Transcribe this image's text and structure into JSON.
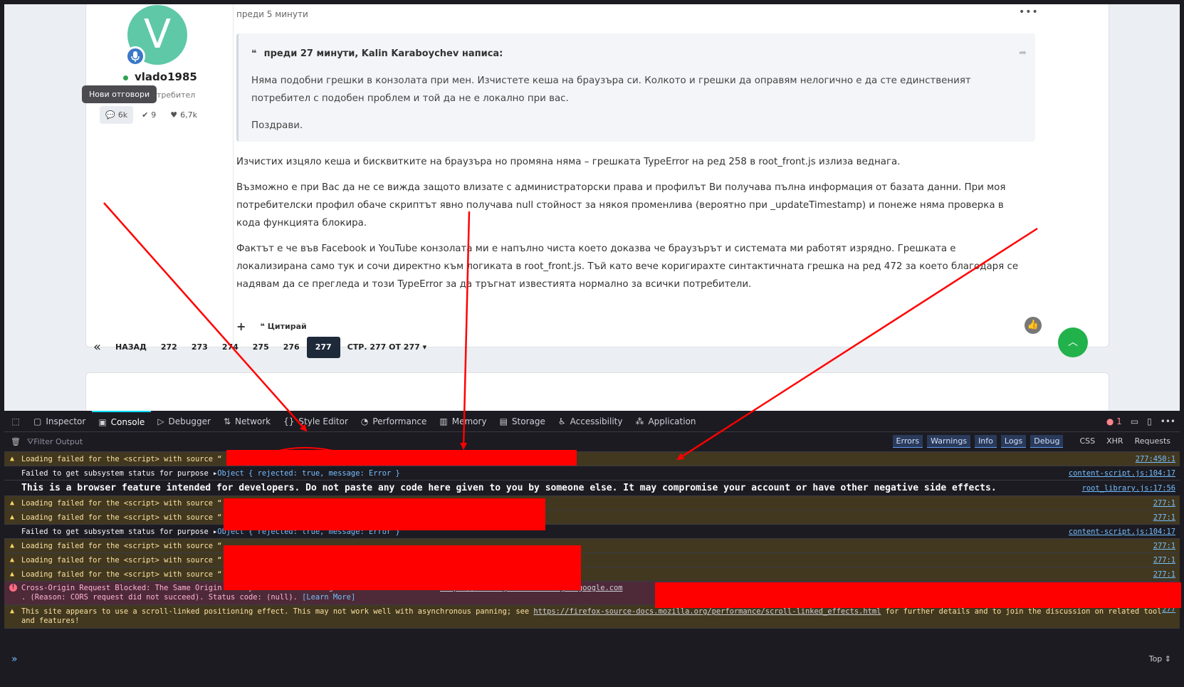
{
  "post": {
    "time": "преди 5 минути",
    "menu": "•••",
    "author": {
      "initial": "V",
      "name": "vlado1985",
      "role": "Потребител",
      "tooltip": "Нови отговори",
      "stats": {
        "posts": "6k",
        "solutions": "9",
        "reputation": "6,7k"
      }
    },
    "quote": {
      "header": "преди 27 минути, Kalin Karaboychev написа:",
      "p1": "Няма подобни грешки в конзолата при мен. Изчистете кеша на браузъра си. Колкото и грешки да оправям нелогично е да сте единственият потребител с подобен проблем и той да не е локално при вас.",
      "p2": "Поздрави."
    },
    "body": [
      "Изчистих изцяло кеша и бисквитките на браузъра но промяна няма – грешката TypeError на ред 258 в root_front.js излиза веднага.",
      "Възможно е при Вас да не се вижда защото влизате с администраторски права и профилът Ви получава пълна информация от базата данни. При моя потребителски профил обаче скриптът явно получава null стойност за някоя променлива (вероятно при _updateTimestamp) и понеже няма проверка в кода функцията блокира.",
      "Фактът е че във Facebook и YouTube конзолата ми е напълно чиста което доказва че браузърът и системата ми работят изрядно. Грешката е локализирана само тук и сочи директно към логиката в root_front.js. Тъй като вече коригирахте синтактичната грешка на ред 472 за което благодаря се надявам да се прегледа и този TypeError за да тръгнат известията нормално за всички потребители."
    ],
    "quote_action": "Цитирай",
    "add_action": "+"
  },
  "pagination": {
    "first": "«",
    "back": "НАЗАД",
    "pages": [
      "272",
      "273",
      "274",
      "275",
      "276",
      "277"
    ],
    "current": "277",
    "page_of": "СТР. 277 ОТ 277"
  },
  "devtools": {
    "tabs": {
      "inspector": "Inspector",
      "console": "Console",
      "debugger": "Debugger",
      "network": "Network",
      "style_editor": "Style Editor",
      "performance": "Performance",
      "memory": "Memory",
      "storage": "Storage",
      "accessibility": "Accessibility",
      "application": "Application"
    },
    "error_count": "1",
    "filter_placeholder": "Filter Output",
    "levels": [
      "Errors",
      "Warnings",
      "Info",
      "Logs",
      "Debug"
    ],
    "request_filters": [
      "CSS",
      "XHR",
      "Requests"
    ],
    "messages": [
      {
        "kind": "warn",
        "text": "Loading failed for the <script> with source “",
        "source": "277:450:1"
      },
      {
        "kind": "log",
        "text": "Failed to get subsystem status for purpose ",
        "obj": "Object { rejected: true, message: Error }",
        "source": "content-script.js:104:17"
      },
      {
        "kind": "log",
        "text": "This is a browser feature intended for developers. Do not paste any code here given to you by someone else. It may compromise your account or have other negative side effects.",
        "source": "root_library.js:17:56"
      },
      {
        "kind": "warn",
        "text": "Loading failed for the <script> with source “",
        "source": "277:1"
      },
      {
        "kind": "warn",
        "text": "Loading failed for the <script> with source “",
        "source": "277:1"
      },
      {
        "kind": "log",
        "text": "Failed to get subsystem status for purpose ",
        "obj": "Object { rejected: true, message: Error }",
        "source": "content-script.js:104:17"
      },
      {
        "kind": "warn",
        "text": "Loading failed for the <script> with source “",
        "source": "277:1"
      },
      {
        "kind": "warn",
        "text": "Loading failed for the <script> with source “",
        "source": "277:1"
      },
      {
        "kind": "warn",
        "text": "Loading failed for the <script> with source “",
        "source": "277:1"
      },
      {
        "kind": "error",
        "text": "Cross-Origin Request Blocked: The Same Origin Policy disallows reading the remote resource at ",
        "url": "https://fundingchoicesmessages.google.com",
        "text2": ". (Reason: CORS request did not succeed). Status code: (null).",
        "learn": "[Learn More]"
      },
      {
        "kind": "warn",
        "text": "This site appears to use a scroll-linked positioning effect. This may not work well with asynchronous panning; see ",
        "url": "https://firefox-source-docs.mozilla.org/performance/scroll-linked_effects.html",
        "text2": " for further details and to join the discussion on related tools and features!",
        "source": "277"
      }
    ],
    "prompt_symbol": "»",
    "context": "Top ⇕"
  },
  "colors": {
    "accent": "#00ddff",
    "annotation": "#ff0000",
    "avatar": "#5ec8a7",
    "scroll_top": "#22b24c"
  }
}
